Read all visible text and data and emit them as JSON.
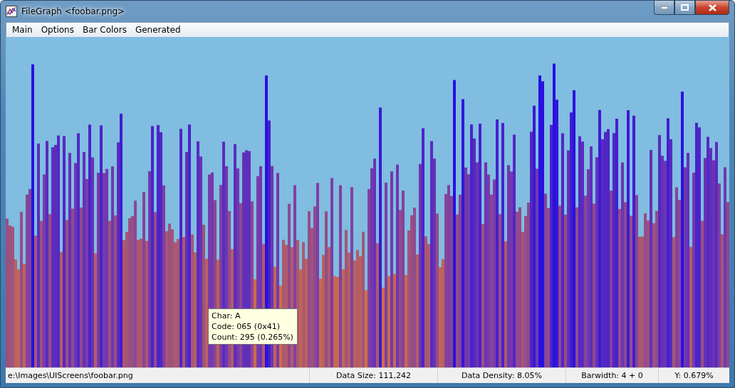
{
  "window": {
    "title": "FileGraph  <foobar.png>"
  },
  "menu": [
    {
      "label": "Main"
    },
    {
      "label": "Options"
    },
    {
      "label": "Bar Colors"
    },
    {
      "label": "Generated"
    }
  ],
  "tooltip": {
    "lines": [
      "Char: A",
      "Code: 065 (0x41)",
      "Count: 295 (0.265%)"
    ]
  },
  "status_bar": [
    {
      "text": "e:\\Images\\UIScreens\\foobar.png"
    },
    {
      "text": "Data Size: 111,242"
    },
    {
      "text": "Data Density: 8.05%"
    },
    {
      "text": "Barwidth: 4 + 0"
    },
    {
      "text": "Y: 0.679%"
    }
  ]
}
